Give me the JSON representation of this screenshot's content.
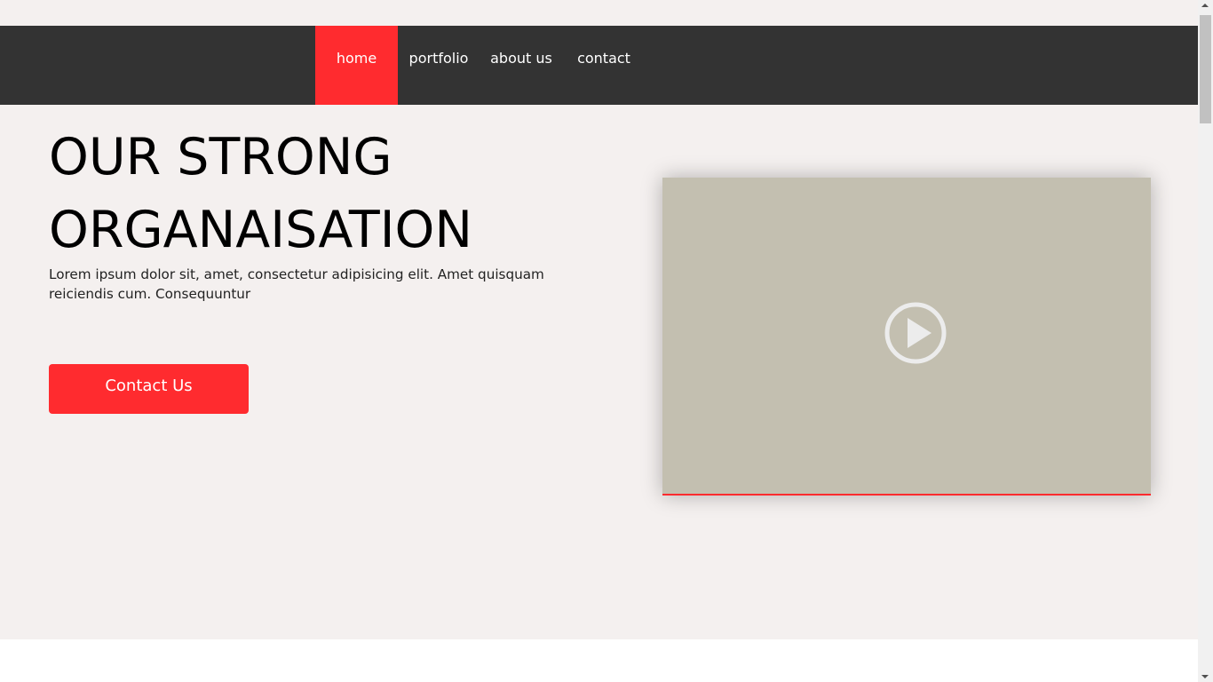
{
  "nav": {
    "items": [
      {
        "label": "home",
        "active": true
      },
      {
        "label": "portfolio",
        "active": false
      },
      {
        "label": "about us",
        "active": false
      },
      {
        "label": "contact",
        "active": false
      }
    ]
  },
  "hero": {
    "title_line1": "OUR STRONG",
    "title_line2": "ORGANAISATION",
    "description": "Lorem ipsum dolor sit, amet, consectetur adipisicing elit. Amet quisquam reiciendis cum. Consequuntur",
    "cta_label": "Contact Us"
  },
  "video": {
    "icon": "play-circle-icon"
  },
  "colors": {
    "accent": "#ff2b2f",
    "navbar_bg": "#333333",
    "page_bg": "#f4f0ef",
    "video_bg": "#c3bfb0"
  }
}
